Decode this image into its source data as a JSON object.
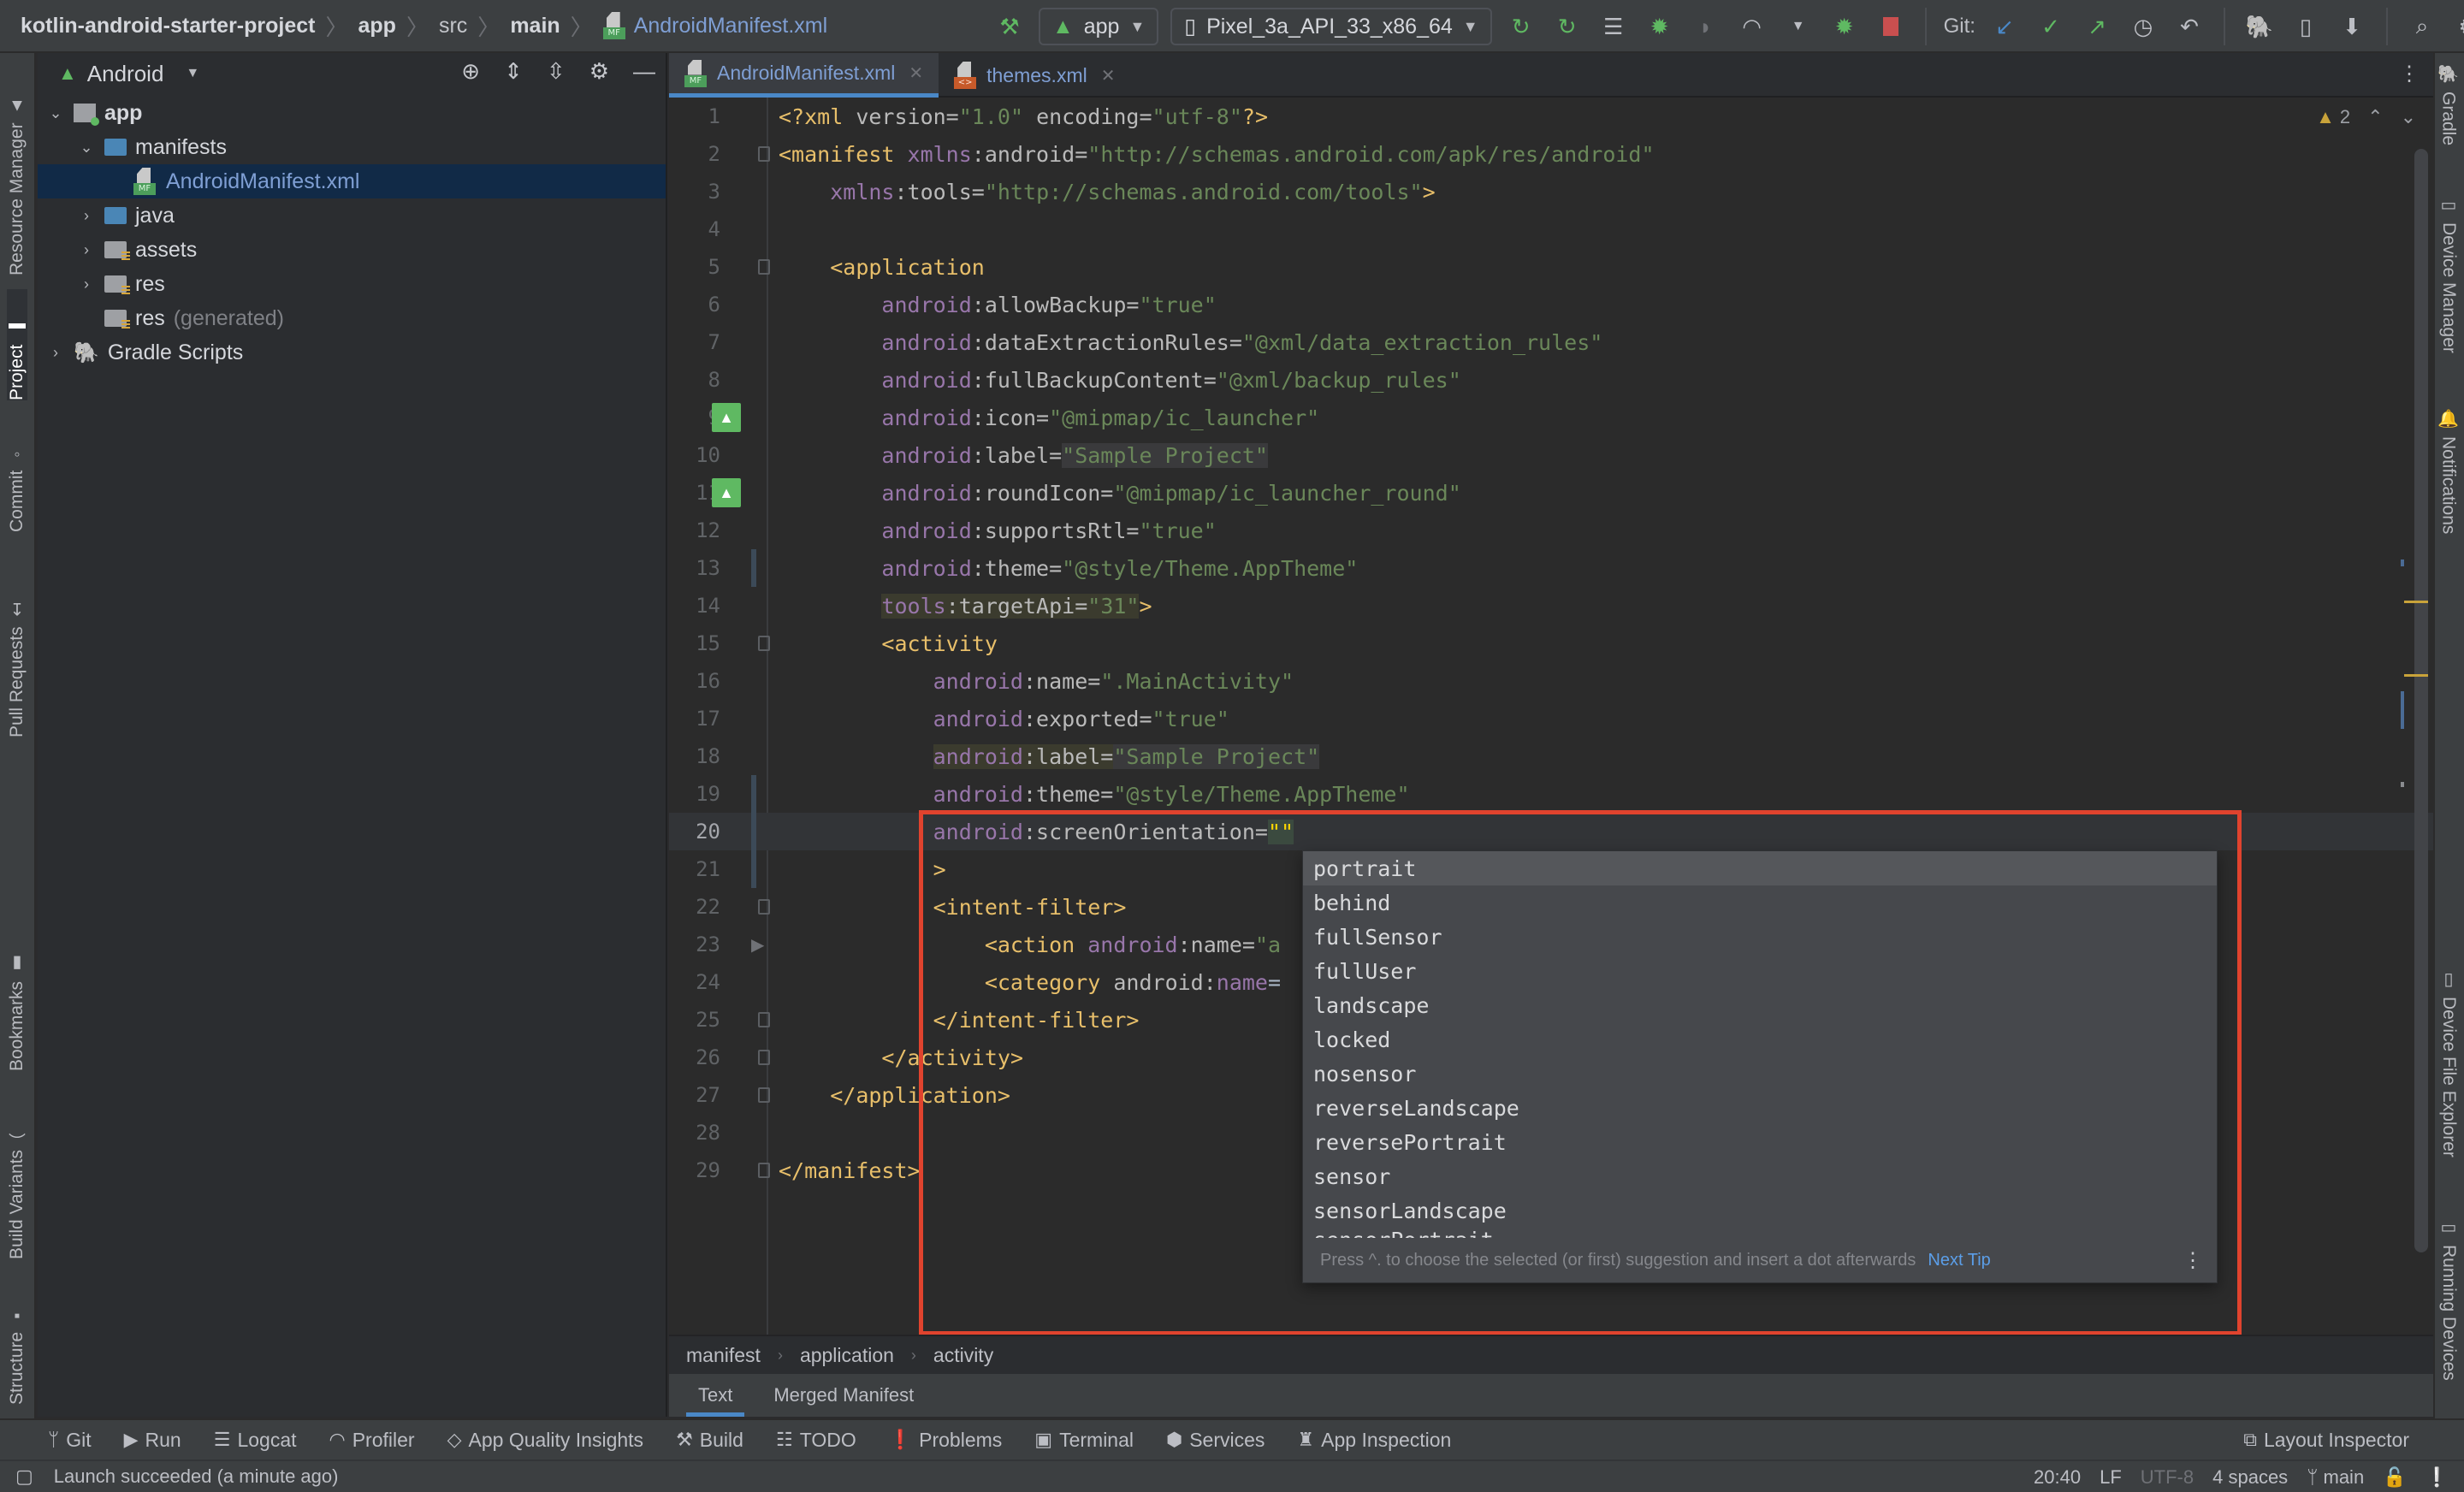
{
  "navbar": {
    "breadcrumbs": [
      "kotlin-android-starter-project",
      "app",
      "src",
      "main"
    ],
    "current_file": "AndroidManifest.xml",
    "run_config": "app",
    "device": "Pixel_3a_API_33_x86_64",
    "git_label": "Git:",
    "icons": [
      "hammer-icon",
      "android-icon",
      "device-icon",
      "apply-changes-icon",
      "apply-code-changes-icon",
      "sync-icon",
      "debug-icon",
      "attach-debugger-icon",
      "profile-icon",
      "attach-profiler-icon",
      "stop-icon",
      "git-update-icon",
      "git-commit-icon",
      "git-push-icon",
      "history-icon",
      "rollback-icon",
      "gradle-sync-icon",
      "avd-manager-icon",
      "sdk-manager-icon",
      "search-icon",
      "settings-icon",
      "avatar"
    ]
  },
  "left_stripe": {
    "tabs": [
      "Resource Manager",
      "Project",
      "Commit",
      "Pull Requests",
      "Bookmarks",
      "Build Variants",
      "Structure"
    ],
    "active": "Project"
  },
  "right_stripe": {
    "tabs": [
      "Gradle",
      "Device Manager",
      "Notifications",
      "Device File Explorer",
      "Running Devices"
    ]
  },
  "project_panel": {
    "view": "Android",
    "tree": [
      {
        "label": "app",
        "level": 0,
        "expanded": true,
        "type": "module"
      },
      {
        "label": "manifests",
        "level": 1,
        "expanded": true,
        "type": "folder"
      },
      {
        "label": "AndroidManifest.xml",
        "level": 2,
        "type": "manifest",
        "selected": true
      },
      {
        "label": "java",
        "level": 1,
        "expanded": false,
        "type": "folder"
      },
      {
        "label": "assets",
        "level": 1,
        "expanded": false,
        "type": "res-folder"
      },
      {
        "label": "res",
        "level": 1,
        "expanded": false,
        "type": "res-folder"
      },
      {
        "label": "res",
        "suffix": "(generated)",
        "level": 1,
        "type": "res-folder"
      },
      {
        "label": "Gradle Scripts",
        "level": 0,
        "expanded": false,
        "type": "gradle"
      }
    ]
  },
  "editor": {
    "tabs": [
      {
        "label": "AndroidManifest.xml",
        "active": true
      },
      {
        "label": "themes.xml",
        "active": false
      }
    ],
    "warnings_count": "2",
    "current_line": 20,
    "lines": [
      "<?xml version=\"1.0\" encoding=\"utf-8\"?>",
      "<manifest xmlns:android=\"http://schemas.android.com/apk/res/android\"",
      "    xmlns:tools=\"http://schemas.android.com/tools\">",
      "",
      "    <application",
      "        android:allowBackup=\"true\"",
      "        android:dataExtractionRules=\"@xml/data_extraction_rules\"",
      "        android:fullBackupContent=\"@xml/backup_rules\"",
      "        android:icon=\"@mipmap/ic_launcher\"",
      "        android:label=\"Sample Project\"",
      "        android:roundIcon=\"@mipmap/ic_launcher_round\"",
      "        android:supportsRtl=\"true\"",
      "        android:theme=\"@style/Theme.AppTheme\"",
      "        tools:targetApi=\"31\">",
      "        <activity",
      "            android:name=\".MainActivity\"",
      "            android:exported=\"true\"",
      "            android:label=\"Sample Project\"",
      "            android:theme=\"@style/Theme.AppTheme\"",
      "            android:screenOrientation=\"\"",
      "            >",
      "            <intent-filter>",
      "                <action android:name=\"a",
      "                <category android:name=",
      "            </intent-filter>",
      "        </activity>",
      "    </application>",
      "",
      "</manifest>"
    ],
    "breadcrumb": [
      "manifest",
      "application",
      "activity"
    ],
    "bottom_tabs": [
      {
        "label": "Text",
        "active": true
      },
      {
        "label": "Merged Manifest",
        "active": false
      }
    ]
  },
  "completion": {
    "items": [
      "portrait",
      "behind",
      "fullSensor",
      "fullUser",
      "landscape",
      "locked",
      "nosensor",
      "reverseLandscape",
      "reversePortrait",
      "sensor",
      "sensorLandscape",
      "sensorPortrait"
    ],
    "selected": "portrait",
    "tip": "Press ^. to choose the selected (or first) suggestion and insert a dot afterwards",
    "next_tip": "Next Tip"
  },
  "tool_windows": [
    {
      "label": "Git",
      "icon": "git-branch-icon"
    },
    {
      "label": "Run",
      "icon": "run-icon"
    },
    {
      "label": "Logcat",
      "icon": "logcat-icon"
    },
    {
      "label": "Profiler",
      "icon": "profiler-icon"
    },
    {
      "label": "App Quality Insights",
      "icon": "diamond-icon"
    },
    {
      "label": "Build",
      "icon": "hammer-icon"
    },
    {
      "label": "TODO",
      "icon": "list-icon"
    },
    {
      "label": "Problems",
      "icon": "problems-icon"
    },
    {
      "label": "Terminal",
      "icon": "terminal-icon"
    },
    {
      "label": "Services",
      "icon": "services-icon"
    },
    {
      "label": "App Inspection",
      "icon": "inspection-icon"
    }
  ],
  "tool_window_right": {
    "label": "Layout Inspector",
    "icon": "layout-inspector-icon"
  },
  "status_bar": {
    "message": "Launch succeeded (a minute ago)",
    "position": "20:40",
    "line_separator": "LF",
    "encoding": "UTF-8",
    "indent": "4 spaces",
    "branch": "main"
  },
  "colors": {
    "accent": "#4a88c7",
    "highlight_box": "#e0432e",
    "xml_tag": "#e8bf6a",
    "xml_namespace": "#9876aa",
    "xml_value": "#6a8759",
    "android_green": "#5fb962"
  }
}
